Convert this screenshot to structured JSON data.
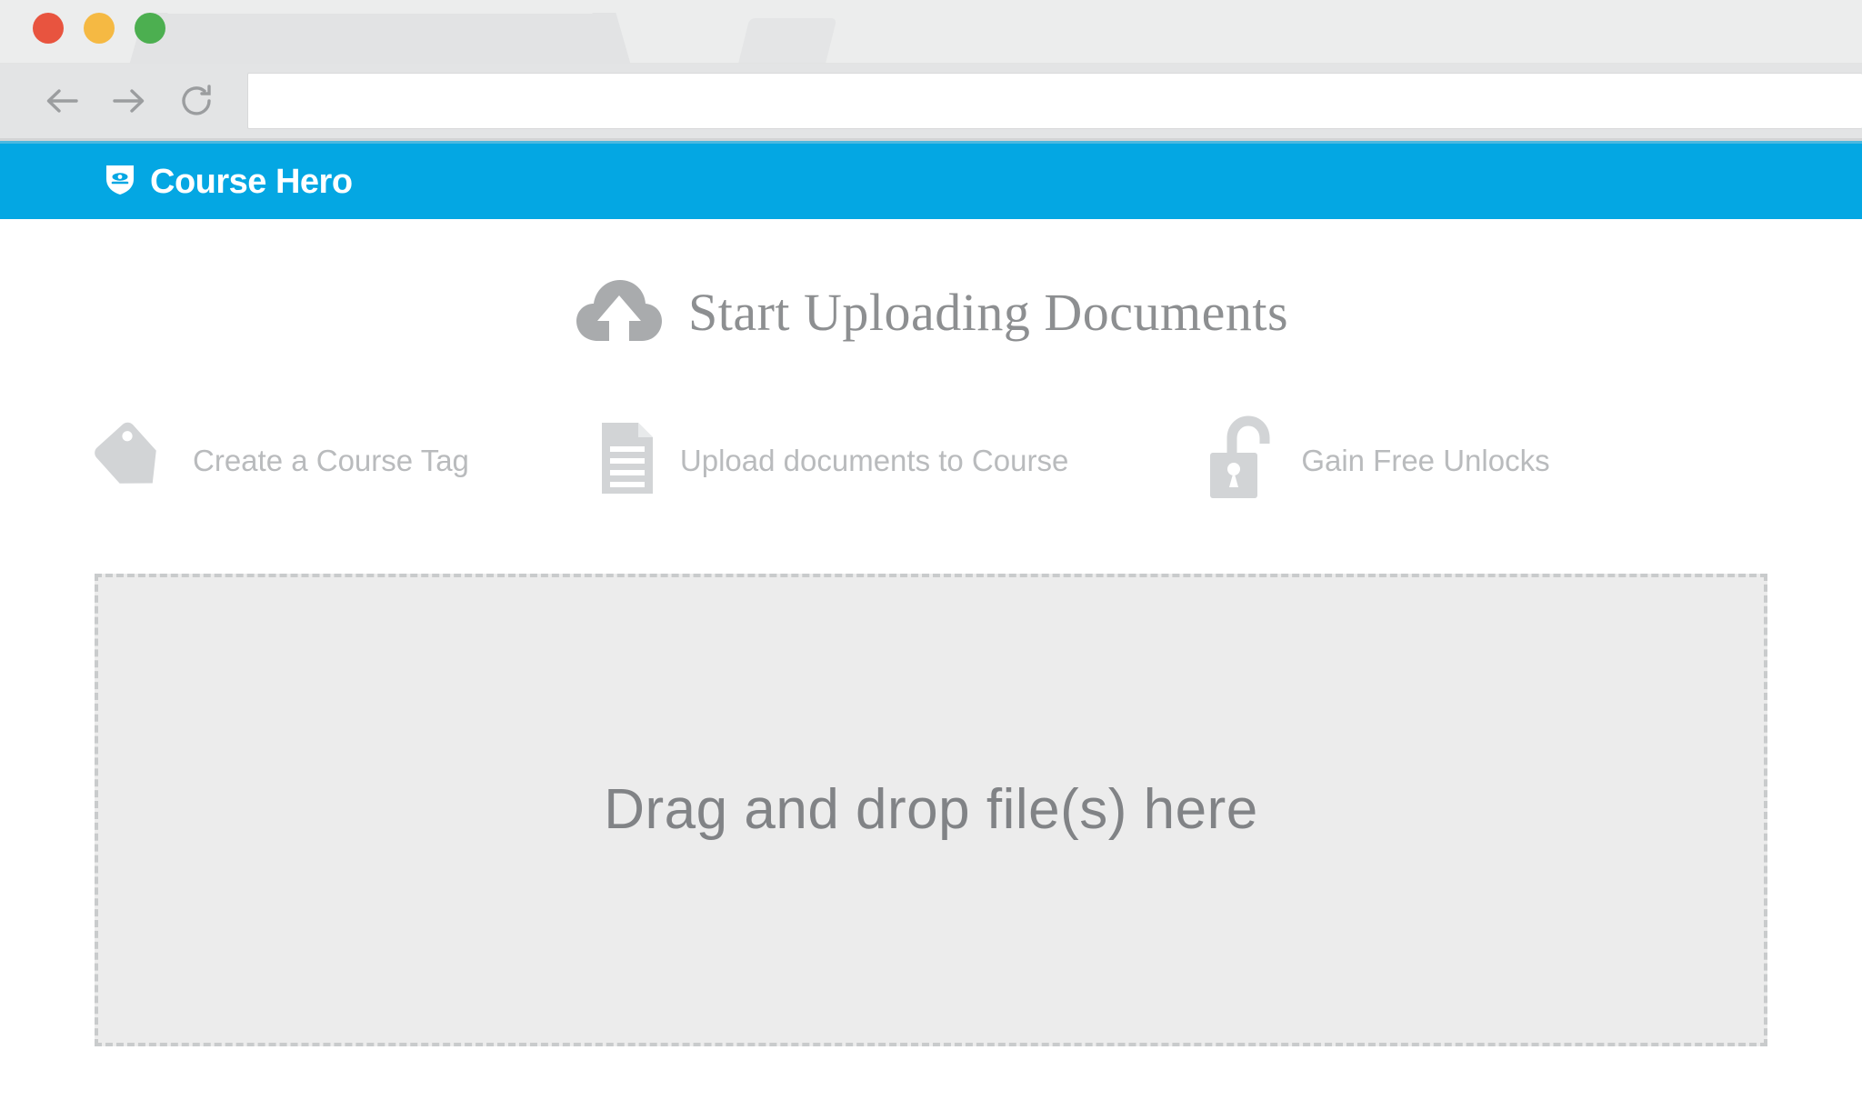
{
  "browser": {
    "traffic_lights": [
      {
        "name": "close",
        "color": "#e8543f"
      },
      {
        "name": "minimize",
        "color": "#f5b943"
      },
      {
        "name": "maximize",
        "color": "#4caf50"
      }
    ],
    "tab": {
      "title": ""
    },
    "new_tab_label": "",
    "nav": {
      "back": "back-arrow",
      "forward": "forward-arrow",
      "reload": "reload-arrow"
    },
    "url_bar": {
      "value": "",
      "placeholder": ""
    }
  },
  "site_header": {
    "brand_name": "Course Hero",
    "logo_icon": "shield-icon",
    "background_color": "#04a7e3"
  },
  "main": {
    "title": "Start Uploading Documents",
    "title_icon": "cloud-upload-icon",
    "features": [
      {
        "icon": "tag-icon",
        "label": "Create a Course Tag"
      },
      {
        "icon": "document-icon",
        "label": "Upload documents to Course"
      },
      {
        "icon": "unlock-icon",
        "label": "Gain Free Unlocks"
      }
    ],
    "dropzone": {
      "text": "Drag and drop file(s) here",
      "fill_color": "#ececec",
      "border_color": "#c9cbcc"
    }
  }
}
